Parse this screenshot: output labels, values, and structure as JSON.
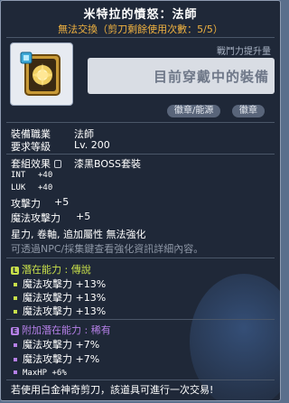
{
  "item": {
    "title": "米特拉的憤怒：法師",
    "trade_notice": "無法交換（剪刀剩餘使用次數：5/5）",
    "icon": "mitra-emblem-icon",
    "combat_power_label": "戰鬥力提升量",
    "equipped_label": "目前穿戴中的裝備",
    "tags": [
      "徽章/能源",
      "徽章"
    ]
  },
  "info": {
    "job_label": "裝備職業",
    "job_value": "法師",
    "level_label": "要求等級",
    "level_value": "Lv. 200"
  },
  "set": {
    "label": "套組效果",
    "value": "漆黑BOSS套裝"
  },
  "stats": [
    {
      "name": "INT",
      "value": "+40"
    },
    {
      "name": "LUK",
      "value": "+40"
    },
    {
      "name": "攻擊力",
      "value": "+5"
    },
    {
      "name": "魔法攻擊力",
      "value": "+5"
    }
  ],
  "flags": {
    "text": "星力, 卷軸, 追加屬性 無法強化",
    "hint": "可透過NPC/採集鍵查看強化資訊詳細內容。"
  },
  "potential": {
    "tag": "L",
    "label": "潛在能力 : 傳說",
    "color": "#c8e04a",
    "lines": [
      "魔法攻擊力 +13%",
      "魔法攻擊力 +13%",
      "魔法攻擊力 +13%"
    ]
  },
  "additional_potential": {
    "tag": "E",
    "label": "附加潛在能力 : 稀有",
    "color": "#b680e8",
    "lines": [
      "魔法攻擊力 +7%",
      "魔法攻擊力 +7%",
      "MaxHP +6%"
    ]
  },
  "footer": "若使用白金神奇剪刀，該道具可進行一次交易!"
}
